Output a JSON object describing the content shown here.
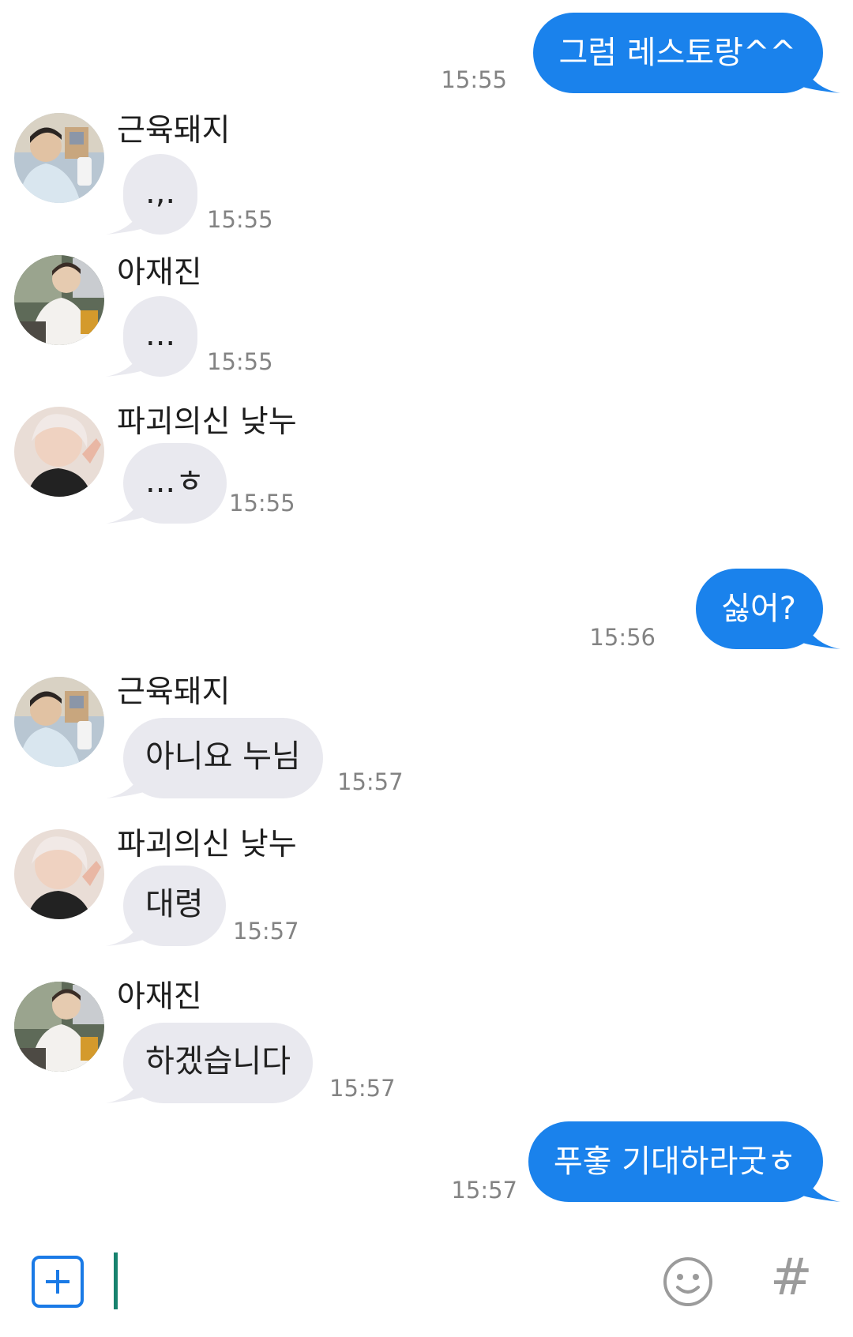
{
  "colors": {
    "outgoing_bubble": "#1a82ec",
    "incoming_bubble": "#e9e9ef",
    "timestamp": "#838383",
    "cursor": "#17826e",
    "accent": "#1a7ae6"
  },
  "messages": [
    {
      "direction": "outgoing",
      "text": "그럼 레스토랑^^",
      "time": "15:55"
    },
    {
      "direction": "incoming",
      "sender": "근육돼지",
      "text": ".,.",
      "time": "15:55"
    },
    {
      "direction": "incoming",
      "sender": "아재진",
      "text": "...",
      "time": "15:55"
    },
    {
      "direction": "incoming",
      "sender": "파괴의신 낮누",
      "text": "...ㅎ",
      "time": "15:55"
    },
    {
      "direction": "outgoing",
      "text": "싫어?",
      "time": "15:56"
    },
    {
      "direction": "incoming",
      "sender": "근육돼지",
      "text": "아니요 누님",
      "time": "15:57"
    },
    {
      "direction": "incoming",
      "sender": "파괴의신 낮누",
      "text": "대령",
      "time": "15:57"
    },
    {
      "direction": "incoming",
      "sender": "아재진",
      "text": "하겠습니다",
      "time": "15:57"
    },
    {
      "direction": "outgoing",
      "text": "푸홓 기대하라굿ㅎ",
      "time": "15:57"
    }
  ],
  "input_bar": {
    "add_icon": "plus-square-icon",
    "emoji_icon": "smiley-icon",
    "hashtag_icon": "hashtag-icon",
    "hashtag_glyph": "#",
    "message_value": ""
  }
}
